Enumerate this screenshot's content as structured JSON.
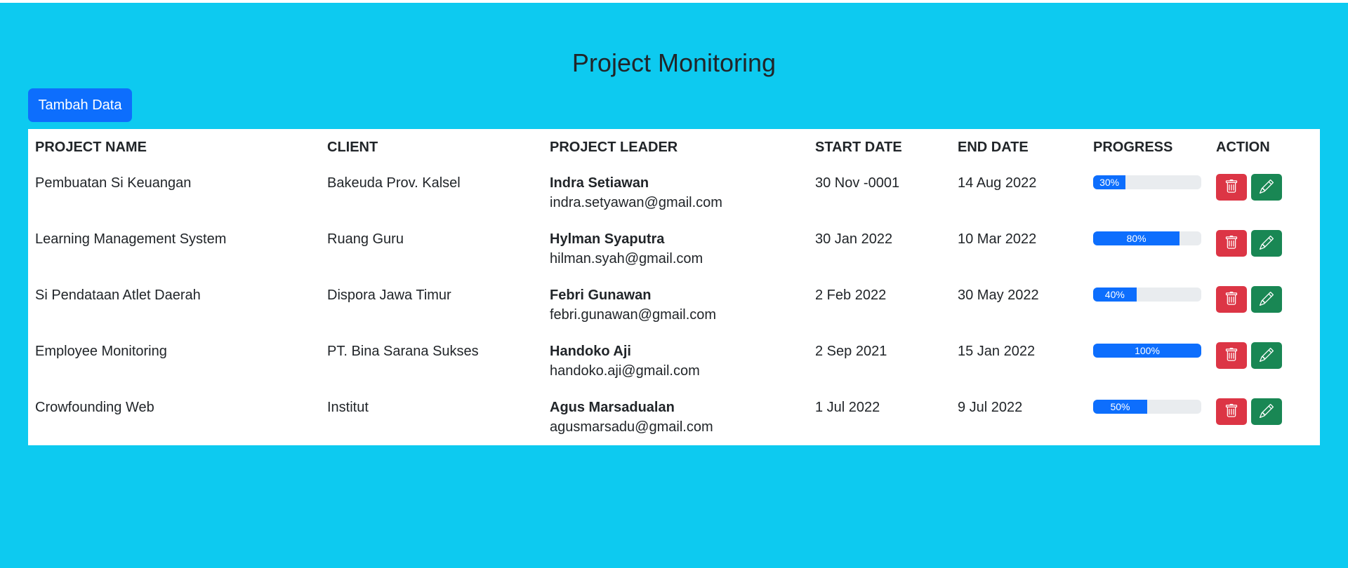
{
  "page": {
    "title": "Project Monitoring",
    "add_button_label": "Tambah Data"
  },
  "table": {
    "headers": [
      "PROJECT NAME",
      "CLIENT",
      "PROJECT LEADER",
      "START DATE",
      "END DATE",
      "PROGRESS",
      "ACTION"
    ],
    "rows": [
      {
        "project_name": "Pembuatan Si Keuangan",
        "client": "Bakeuda Prov. Kalsel",
        "leader_name": "Indra Setiawan",
        "leader_email": "indra.setyawan@gmail.com",
        "start_date": "30 Nov -0001",
        "end_date": "14 Aug 2022",
        "progress": 30,
        "progress_label": "30%"
      },
      {
        "project_name": "Learning Management System",
        "client": "Ruang Guru",
        "leader_name": "Hylman Syaputra",
        "leader_email": "hilman.syah@gmail.com",
        "start_date": "30 Jan 2022",
        "end_date": "10 Mar 2022",
        "progress": 80,
        "progress_label": "80%"
      },
      {
        "project_name": "Si Pendataan Atlet Daerah",
        "client": "Dispora Jawa Timur",
        "leader_name": "Febri Gunawan",
        "leader_email": "febri.gunawan@gmail.com",
        "start_date": "2 Feb 2022",
        "end_date": "30 May 2022",
        "progress": 40,
        "progress_label": "40%"
      },
      {
        "project_name": "Employee Monitoring",
        "client": "PT. Bina Sarana Sukses",
        "leader_name": "Handoko Aji",
        "leader_email": "handoko.aji@gmail.com",
        "start_date": "2 Sep 2021",
        "end_date": "15 Jan 2022",
        "progress": 100,
        "progress_label": "100%"
      },
      {
        "project_name": "Crowfounding Web",
        "client": "Institut",
        "leader_name": "Agus Marsadualan",
        "leader_email": "agusmarsadu@gmail.com",
        "start_date": "1 Jul 2022",
        "end_date": "9 Jul 2022",
        "progress": 50,
        "progress_label": "50%"
      }
    ],
    "action_icons": [
      "trash-icon",
      "pencil-icon"
    ]
  },
  "colors": {
    "background": "#0dcaf0",
    "primary": "#0d6efd",
    "danger": "#dc3545",
    "success": "#198754",
    "progress_track": "#e9ecef"
  }
}
